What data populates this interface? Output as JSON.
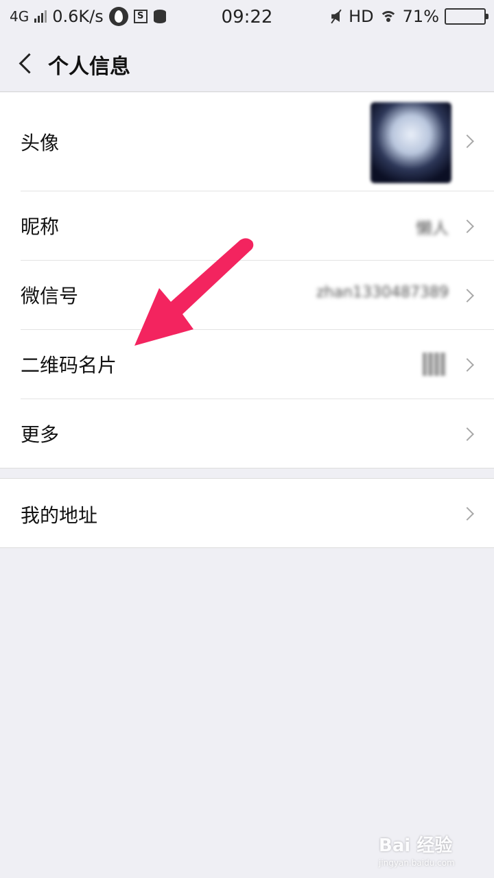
{
  "status_bar": {
    "network": "4G",
    "speed": "0.6K/s",
    "time": "09:22",
    "hd": "HD",
    "battery": "71%",
    "battery_level": 0.71
  },
  "navbar": {
    "back_icon": "chevron-left-icon",
    "title": "个人信息"
  },
  "profile_items": [
    {
      "label": "头像",
      "value": ""
    },
    {
      "label": "昵称",
      "value": "懒人"
    },
    {
      "label": "微信号",
      "value": "zhan1330487389"
    },
    {
      "label": "二维码名片",
      "value": ""
    },
    {
      "label": "更多",
      "value": ""
    }
  ],
  "address_item": {
    "label": "我的地址"
  },
  "annotation": {
    "color": "#f3245f"
  },
  "watermark": {
    "text": "Bai 经验",
    "subtext": "jingyan.baidu.com"
  }
}
